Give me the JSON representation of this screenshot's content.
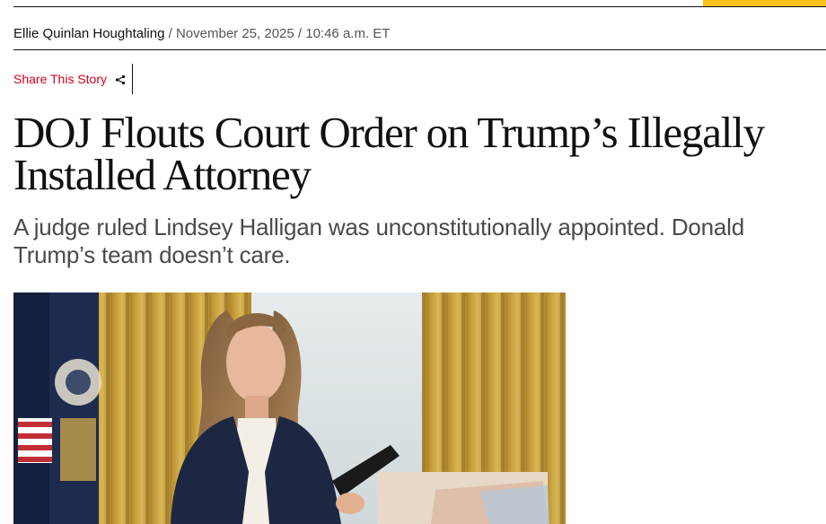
{
  "byline": {
    "author": "Ellie Quinlan Houghtaling",
    "separator": "/",
    "date": "November 25, 2025",
    "time": "10:46 a.m. ET"
  },
  "share": {
    "label": "Share This Story",
    "icon": "share-icon"
  },
  "headline": {
    "line1": "DOJ Flouts Court Order on Trump’s Illegally",
    "line2": "Installed Attorney"
  },
  "dek": "A judge ruled Lindsey Halligan was unconstitutionally appointed. Donald Trump’s team doesn’t care.",
  "colors": {
    "accent_yellow": "#f7c21b",
    "share_red": "#d0021b",
    "dek_gray": "#4a4a4a"
  }
}
